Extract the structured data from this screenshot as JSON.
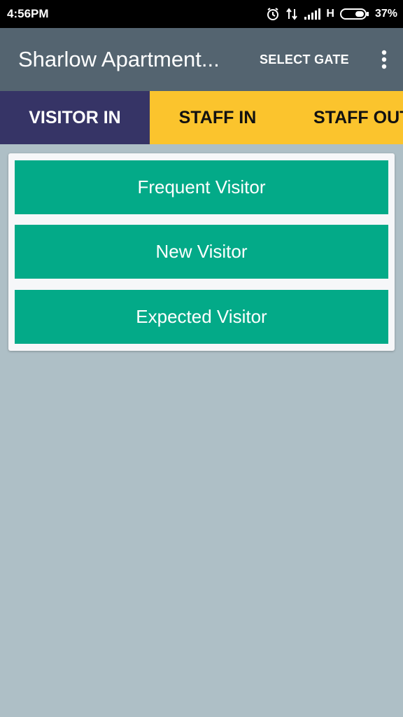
{
  "status_bar": {
    "time": "4:56PM",
    "network": "H",
    "battery": "37%",
    "icons": [
      "alarm-icon",
      "data-transfer-icon",
      "signal-icon",
      "battery-icon"
    ]
  },
  "app_bar": {
    "title": "Sharlow Apartment...",
    "select_gate_label": "SELECT GATE",
    "overflow_icon": "more-vert-icon",
    "background": "#546470"
  },
  "tabs": [
    {
      "label": "VISITOR IN",
      "active": true
    },
    {
      "label": "STAFF IN",
      "active": false
    },
    {
      "label": "STAFF OUT",
      "active": false
    }
  ],
  "visitor_options": [
    {
      "label": "Frequent Visitor"
    },
    {
      "label": "New Visitor"
    },
    {
      "label": "Expected Visitor"
    }
  ],
  "colors": {
    "active_tab": "#363466",
    "tab_bar": "#fbc42d",
    "button": "#03aa88",
    "page_background": "#aebfc6"
  }
}
